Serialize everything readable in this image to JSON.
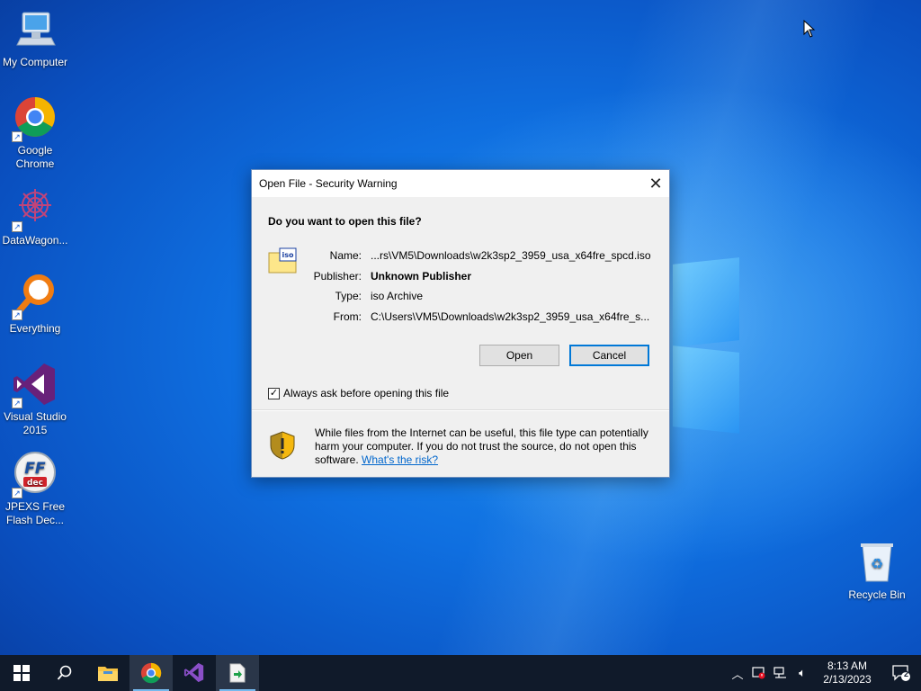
{
  "desktop": {
    "icons": [
      {
        "label": "My Computer"
      },
      {
        "label": "Google Chrome"
      },
      {
        "label": "DataWagon..."
      },
      {
        "label": "Everything"
      },
      {
        "label": "Visual Studio 2015"
      },
      {
        "label": "JPEXS Free Flash Dec..."
      },
      {
        "label": "Recycle Bin"
      }
    ]
  },
  "dialog": {
    "title": "Open File - Security Warning",
    "question": "Do you want to open this file?",
    "file_icon_text": "iso",
    "fields": [
      {
        "label": "Name:",
        "value": "...rs\\VM5\\Downloads\\w2k3sp2_3959_usa_x64fre_spcd.iso"
      },
      {
        "label": "Publisher:",
        "value": "Unknown Publisher"
      },
      {
        "label": "Type:",
        "value": "iso Archive"
      },
      {
        "label": "From:",
        "value": "C:\\Users\\VM5\\Downloads\\w2k3sp2_3959_usa_x64fre_s..."
      }
    ],
    "open_label": "Open",
    "cancel_label": "Cancel",
    "checkbox_label": "Always ask before opening this file",
    "checkbox_checked": true,
    "warning_text": "While files from the Internet can be useful, this file type can potentially harm your computer. If you do not trust the source, do not open this software.",
    "risk_link": "What's the risk?"
  },
  "taskbar": {
    "time": "8:13 AM",
    "date": "2/13/2023",
    "notification_count": "2"
  },
  "colors": {
    "accent": "#0078d7",
    "taskbar": "#101a2a",
    "link": "#0066cc"
  }
}
